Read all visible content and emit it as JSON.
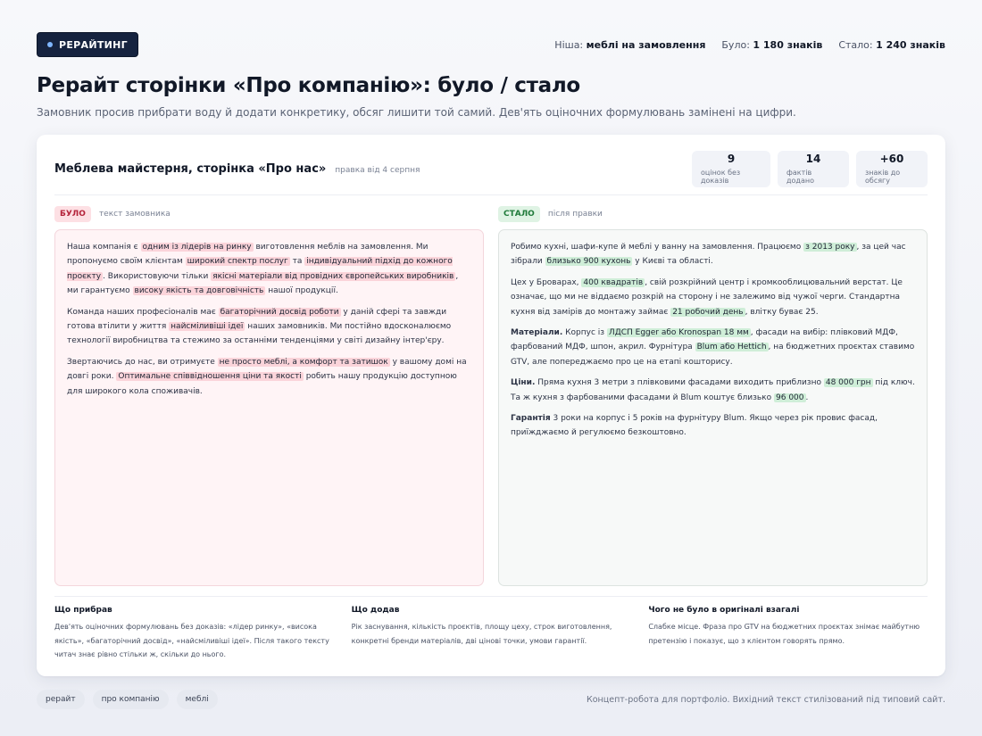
{
  "header": {
    "badge": "РЕРАЙТИНГ",
    "niche_label": "Ніша:",
    "niche_value": "меблі на замовлення",
    "before_label": "Було:",
    "before_value": "1 180 знаків",
    "after_label": "Стало:",
    "after_value": "1 240 знаків"
  },
  "title": "Рерайт сторінки «Про компанію»: було / стало",
  "subtitle": "Замовник просив прибрати воду й додати конкретику, обсяг лишити той самий. Дев'ять оціночних формулювань замінені на цифри.",
  "card": {
    "title": "Меблева майстерня, сторінка «Про нас»",
    "date": "правка від 4 серпня",
    "stats": [
      {
        "value": "9",
        "label": "оцінок без доказів"
      },
      {
        "value": "14",
        "label": "фактів додано"
      },
      {
        "value": "+60",
        "label": "знаків до обсягу"
      }
    ],
    "before": {
      "tag": "БУЛО",
      "caption": "текст замовника",
      "p1": [
        "Наша компанія є ",
        "одним із лідерів на ринку",
        " виготовлення меблів на замовлення. Ми пропонуємо своїм клієнтам ",
        "широкий спектр послуг",
        " та ",
        "індивідуальний підхід до кожного проєкту",
        ". Використовуючи тільки ",
        "якісні матеріали від провідних європейських виробників",
        ", ми гарантуємо ",
        "високу якість та довговічність",
        " нашої продукції."
      ],
      "p2": [
        "Команда наших професіоналів має ",
        "багаторічний досвід роботи",
        " у даній сфері та завжди готова втілити у життя ",
        "найсміливіші ідеї",
        " наших замовників. Ми постійно вдосконалюємо технології виробництва та стежимо за останніми тенденціями у світі дизайну інтер'єру."
      ],
      "p3": [
        "Звертаючись до нас, ви отримуєте ",
        "не просто меблі, а комфорт та затишок",
        " у вашому домі на довгі роки. ",
        "Оптимальне співвідношення ціни та якості",
        " робить нашу продукцію доступною для широкого кола споживачів."
      ]
    },
    "after": {
      "tag": "СТАЛО",
      "caption": "після правки",
      "p1": [
        "Робимо кухні, шафи-купе й меблі у ванну на замовлення. Працюємо ",
        "з 2013 року",
        ", за цей час зібрали ",
        "близько 900 кухонь",
        " у Києві та області."
      ],
      "p2": [
        "Цех у Броварах, ",
        "400 квадратів",
        ", свій розкрійний центр і кромкооблицювальний верстат. Це означає, що ми не віддаємо розкрій на сторону і не залежимо від чужої черги. Стандартна кухня від замірів до монтажу займає ",
        "21 робочий день",
        ", влітку буває 25."
      ],
      "p3": [
        "Матеріали.",
        " Корпус із ",
        "ЛДСП Egger або Kronospan 18 мм",
        ", фасади на вибір: плівковий МДФ, фарбований МДФ, шпон, акрил. Фурнітура ",
        "Blum або Hettich",
        ", на бюджетних проєктах ставимо GTV, але попереджаємо про це на етапі кошторису."
      ],
      "p4": [
        "Ціни.",
        " Пряма кухня 3 метри з плівковими фасадами виходить приблизно ",
        "48 000 грн",
        " під ключ. Та ж кухня з фарбованими фасадами й Blum коштує близько ",
        "96 000",
        "."
      ],
      "p5": [
        "Гарантія",
        " 3 роки на корпус і 5 років на фурнітуру Blum. Якщо через рік провис фасад, приїжджаємо й регулюємо безкоштовно."
      ]
    },
    "notes": [
      {
        "title": "Що прибрав",
        "text": "Дев'ять оціночних формулювань без доказів: «лідер ринку», «висока якість», «багаторічний досвід», «найсміливіші ідеї». Після такого тексту читач знає рівно стільки ж, скільки до нього."
      },
      {
        "title": "Що додав",
        "text": "Рік заснування, кількість проєктів, площу цеху, строк виготовлення, конкретні бренди матеріалів, дві цінові точки, умови гарантії."
      },
      {
        "title": "Чого не було в оригіналі взагалі",
        "text": "Слабке місце. Фраза про GTV на бюджетних проєктах знімає майбутню претензію і показує, що з клієнтом говорять прямо."
      }
    ]
  },
  "footer": {
    "chips": [
      "рерайт",
      "про компанію",
      "меблі"
    ],
    "note": "Концепт-робота для портфоліо. Вихідний текст стилізований під типовий сайт."
  }
}
